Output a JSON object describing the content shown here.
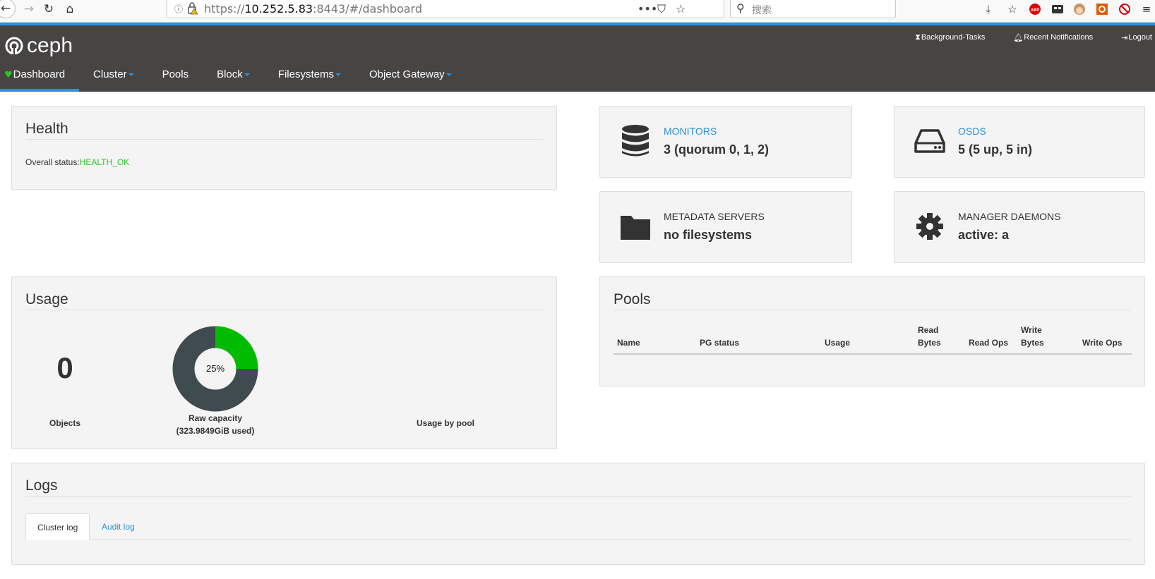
{
  "browser": {
    "url_prefix": "https://",
    "url_host": "10.252.5.83",
    "url_rest": ":8443/#/dashboard",
    "search_placeholder": "搜索"
  },
  "header": {
    "logo": "ceph",
    "top_links": [
      "Background-Tasks",
      "Recent Notifications",
      "Logout"
    ],
    "nav": [
      {
        "label": "Dashboard",
        "active": true,
        "dropdown": false
      },
      {
        "label": "Cluster",
        "dropdown": true
      },
      {
        "label": "Pools",
        "dropdown": false
      },
      {
        "label": "Block",
        "dropdown": true
      },
      {
        "label": "Filesystems",
        "dropdown": true
      },
      {
        "label": "Object Gateway",
        "dropdown": true
      }
    ]
  },
  "health": {
    "title": "Health",
    "status_label": "Overall status:",
    "status_value": "HEALTH_OK",
    "status_color": "#2bc32b"
  },
  "cards": {
    "monitors": {
      "label": "MONITORS",
      "value": "3 (quorum 0, 1, 2)",
      "icon": "database-icon"
    },
    "osds": {
      "label": "OSDS",
      "value": "5 (5 up, 5 in)",
      "icon": "hard-drive-icon"
    },
    "metadata": {
      "label": "METADATA SERVERS",
      "value": "no filesystems",
      "icon": "folder-icon"
    },
    "managers": {
      "label": "MANAGER DAEMONS",
      "value": "active: a",
      "icon": "gear-icon"
    }
  },
  "usage": {
    "title": "Usage",
    "objects_value": "0",
    "objects_label": "Objects",
    "raw_percent": "25%",
    "raw_fraction": 0.25,
    "raw_label": "Raw capacity",
    "raw_used": "(323.9849GiB used)",
    "pool_label": "Usage by pool",
    "used_color": "#00bb00",
    "free_color": "#3f4b4f"
  },
  "pools": {
    "title": "Pools",
    "columns": [
      "Name",
      "PG status",
      "Usage",
      "Read Bytes",
      "Read Ops",
      "Write Bytes",
      "Write Ops"
    ]
  },
  "logs": {
    "title": "Logs",
    "tabs": [
      "Cluster log",
      "Audit log"
    ]
  }
}
